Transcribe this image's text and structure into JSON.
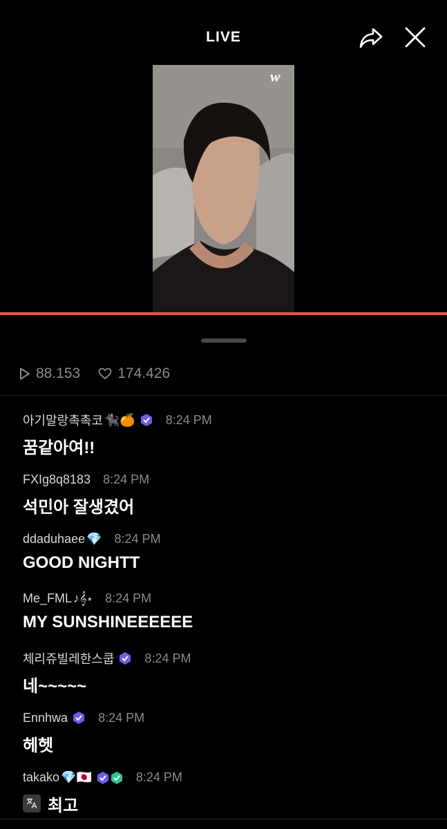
{
  "header": {
    "title": "LIVE"
  },
  "stats": {
    "plays": "88.153",
    "likes": "174.426"
  },
  "chat": [
    {
      "user": "아기말랑촉촉코",
      "emoji": "🐈‍⬛🍊",
      "badge": true,
      "time": "8:24 PM",
      "text": "꿈같아여!!"
    },
    {
      "user": "FXIg8q8183",
      "emoji": "",
      "badge": false,
      "time": "8:24 PM",
      "text": "석민아 잘생겼어"
    },
    {
      "user": "ddaduhaee",
      "emoji": "💎",
      "badge": false,
      "time": "8:24 PM",
      "text": "GOOD NIGHTT"
    },
    {
      "user": "Me_FML",
      "emoji": "♪𝄞⋆",
      "badge": false,
      "time": "8:24 PM",
      "text": "MY SUNSHINEEEEEE"
    },
    {
      "user": "체리쥬빌레한스쿱",
      "emoji": "",
      "badge": true,
      "time": "8:24 PM",
      "text": "네~~~~~"
    },
    {
      "user": "Ennhwa",
      "emoji": "",
      "badge": true,
      "time": "8:24 PM",
      "text": "헤헷"
    },
    {
      "user": "takako",
      "emoji": "💎🇯🇵",
      "badge": true,
      "time": "8:24 PM",
      "text": "최고"
    }
  ],
  "colors": {
    "progress": "#e9564d",
    "badge": "#6d5ce8",
    "badge_green": "#2ec48d"
  }
}
